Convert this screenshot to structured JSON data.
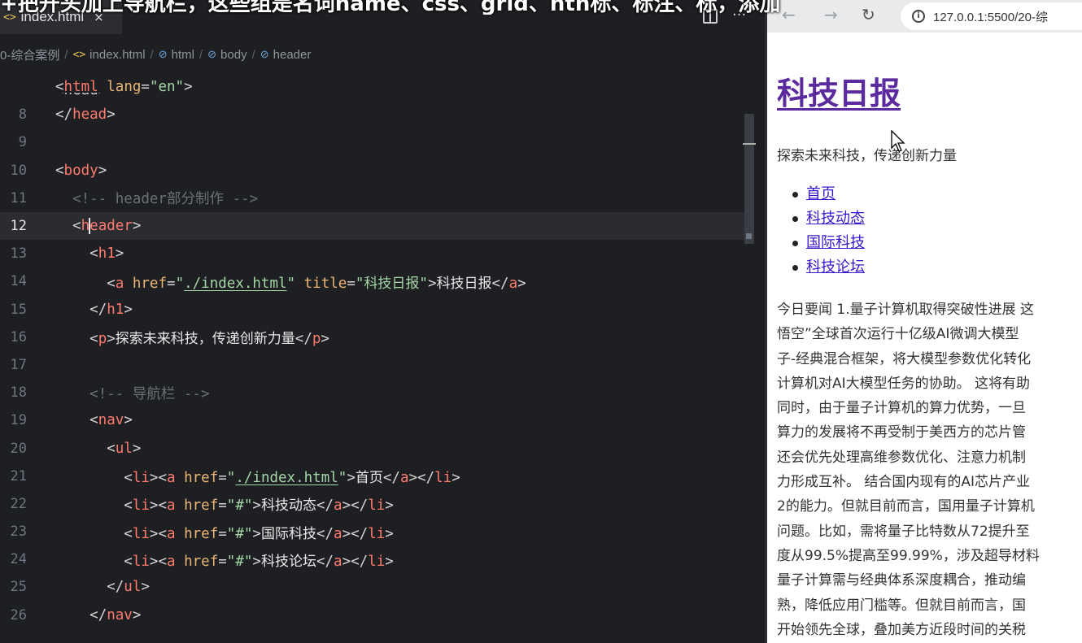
{
  "editor": {
    "tab": {
      "icon": "<>",
      "label": "index.html",
      "close": "×"
    },
    "more_label": "···",
    "breadcrumb": [
      "0-综合案例",
      "index.html",
      "html",
      "body",
      "header"
    ]
  },
  "browser": {
    "url": "127.0.0.1:5500/20-综",
    "page": {
      "title": "科技日报",
      "tagline": "探索未来科技，传递创新力量",
      "nav": [
        "首页",
        "科技动态",
        "国际科技",
        "科技论坛"
      ],
      "article_lines": [
        "今日要闻 1.量子计算机取得突破性进展 这",
        "悟空”全球首次运行十亿级AI微调大模型",
        "子-经典混合框架，将大模型参数优化转化",
        "计算机对AI大模型任务的协助。 这将有助",
        "同时，由于量子计算机的算力优势，一旦",
        "算力的发展将不再受制于美西方的芯片管",
        "还会优先处理高维参数优化、注意力机制",
        "力形成互补。 结合国内现有的AI芯片产业",
        "2的能力。但就目前而言，国用量子计算机",
        "问题。比如，需将量子比特数从72提升至",
        "度从99.5%提高至99.99%，涉及超导材料",
        "量子计算需与经典体系深度耦合，推动编",
        "熟，降低应用门槛等。但就目前而言，国",
        "开始领先全球，叠加美方近段时间的关税"
      ]
    }
  },
  "overlay_caption": "+把开头加上导航栏，这些组是名词name、css、grid、nth标、标注、标，添加"
}
